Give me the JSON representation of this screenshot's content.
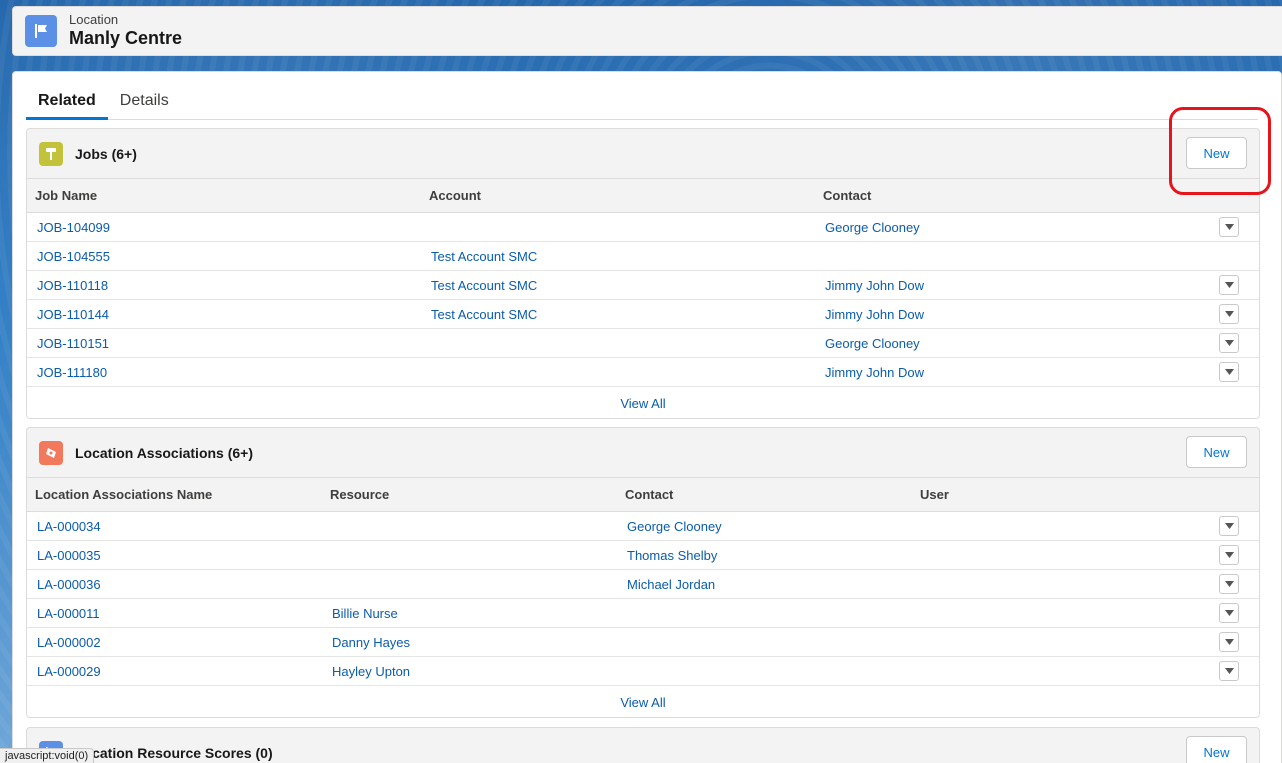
{
  "header": {
    "object_type": "Location",
    "record_name": "Manly Centre",
    "icon": "flag-icon",
    "icon_color": "#5c8fe6"
  },
  "tabs": [
    {
      "label": "Related",
      "active": true
    },
    {
      "label": "Details",
      "active": false
    }
  ],
  "jobs": {
    "title": "Jobs (6+)",
    "icon": "hammer-icon",
    "icon_color": "#c2c23b",
    "new_label": "New",
    "columns": [
      "Job Name",
      "Account",
      "Contact"
    ],
    "rows": [
      {
        "job": "JOB-104099",
        "account": "",
        "contact": "George Clooney"
      },
      {
        "job": "JOB-104555",
        "account": "Test Account SMC",
        "contact": ""
      },
      {
        "job": "JOB-110118",
        "account": "Test Account SMC",
        "contact": "Jimmy John Dow"
      },
      {
        "job": "JOB-110144",
        "account": "Test Account SMC",
        "contact": "Jimmy John Dow"
      },
      {
        "job": "JOB-110151",
        "account": "",
        "contact": "George Clooney"
      },
      {
        "job": "JOB-111180",
        "account": "",
        "contact": "Jimmy John Dow"
      }
    ],
    "view_all": "View All"
  },
  "location_associations": {
    "title": "Location Associations (6+)",
    "icon": "ticket-icon",
    "icon_color": "#f2795c",
    "new_label": "New",
    "columns": [
      "Location Associations Name",
      "Resource",
      "Contact",
      "User"
    ],
    "rows": [
      {
        "name": "LA-000034",
        "resource": "",
        "contact": "George Clooney",
        "user": ""
      },
      {
        "name": "LA-000035",
        "resource": "",
        "contact": "Thomas Shelby",
        "user": ""
      },
      {
        "name": "LA-000036",
        "resource": "",
        "contact": "Michael Jordan",
        "user": ""
      },
      {
        "name": "LA-000011",
        "resource": "Billie Nurse",
        "contact": "",
        "user": ""
      },
      {
        "name": "LA-000002",
        "resource": "Danny Hayes",
        "contact": "",
        "user": ""
      },
      {
        "name": "LA-000029",
        "resource": "Hayley Upton",
        "contact": "",
        "user": ""
      }
    ],
    "view_all": "View All"
  },
  "location_resource_scores": {
    "title": "Location Resource Scores (0)",
    "icon": "flag-icon",
    "icon_color": "#5c8fe6",
    "new_label": "New"
  },
  "status_bar": "javascript:void(0)",
  "highlight_color": "#e5151b"
}
